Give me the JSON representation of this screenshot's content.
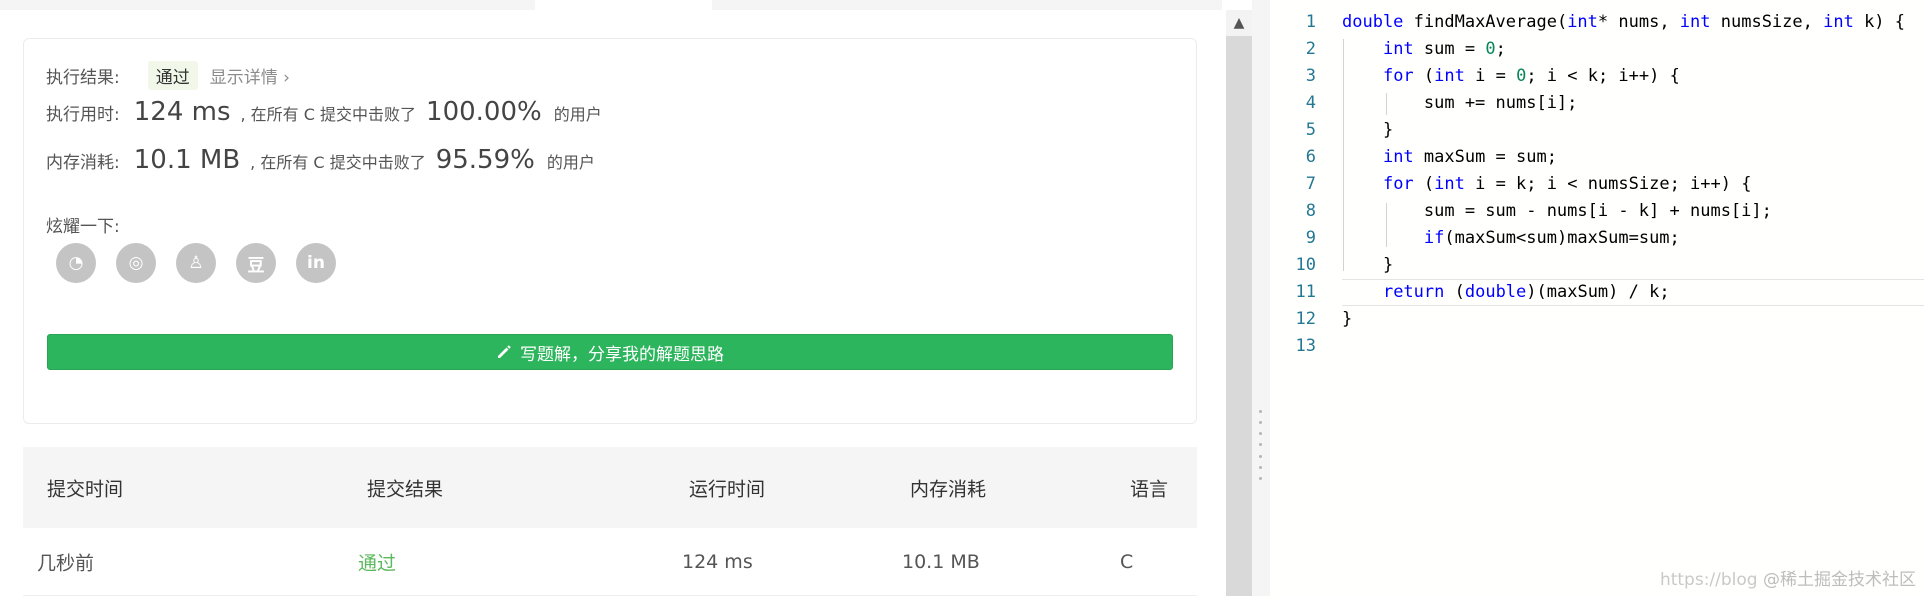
{
  "result": {
    "label": "执行结果:",
    "status": "通过",
    "details_link": "显示详情 ›",
    "runtime_label": "执行用时:",
    "runtime_value": "124 ms",
    "runtime_text": ", 在所有 C 提交中击败了",
    "runtime_pct": "100.00%",
    "runtime_suffix": "的用户",
    "memory_label": "内存消耗:",
    "memory_value": "10.1 MB",
    "memory_text": ", 在所有 C 提交中击败了",
    "memory_pct": "95.59%",
    "memory_suffix": "的用户",
    "share_label": "炫耀一下:",
    "share_icons": [
      {
        "icon": "wechat-icon",
        "glyph": "◔"
      },
      {
        "icon": "weibo-icon",
        "glyph": "◎"
      },
      {
        "icon": "qq-icon",
        "glyph": "♙"
      },
      {
        "icon": "douban-icon",
        "glyph": "豆"
      },
      {
        "icon": "linkedin-icon",
        "glyph": "in"
      }
    ],
    "write_solution_label": "写题解，分享我的解题思路"
  },
  "table": {
    "headers": [
      "提交时间",
      "提交结果",
      "运行时间",
      "内存消耗",
      "语言"
    ],
    "rows": [
      [
        "几秒前",
        "通过",
        "124 ms",
        "10.1 MB",
        "C"
      ]
    ]
  },
  "editor": {
    "line_numbers": [
      "1",
      "2",
      "3",
      "4",
      "5",
      "6",
      "7",
      "8",
      "9",
      "10",
      "11",
      "12",
      "13"
    ]
  },
  "watermark": {
    "url": "https://blog",
    "brand": "@稀土掘金技术社区"
  },
  "colors": {
    "accent_green": "#2db55d",
    "pass_text": "#5cb85c",
    "keyword": "#0000ff",
    "number": "#098658",
    "line_number": "#237893"
  }
}
